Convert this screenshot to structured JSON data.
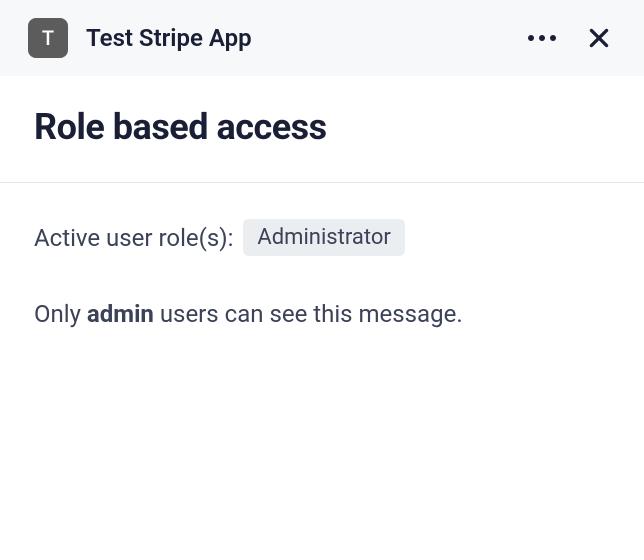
{
  "header": {
    "app_icon_letter": "T",
    "app_name": "Test Stripe App"
  },
  "title": "Role based access",
  "content": {
    "role_label": "Active user role(s):",
    "role_value": "Administrator",
    "message_prefix": "Only ",
    "message_bold": "admin",
    "message_suffix": " users can see this message."
  }
}
